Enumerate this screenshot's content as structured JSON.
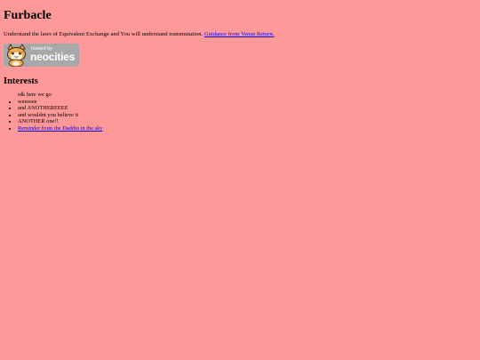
{
  "page": {
    "title": "Furbacle",
    "intro_text": "Understand the laws of Equivalent Exchange and You will understand transmutation.",
    "intro_link": "Guidance from Venus Return.",
    "badge": {
      "small_text": "hosted by",
      "big_text": "neocities",
      "bg_color": "#a8a8a8"
    },
    "interests_heading": "Interests",
    "interests": [
      "idk here we go",
      "weeeeee",
      "and ANOTHEREEEE",
      "and wouldnt you believe it",
      "ANOTHER one!!"
    ],
    "interests_link": "Reminder from the Daddio in the sky",
    "colors": {
      "background": "#ff9999",
      "link": "#0000ee"
    }
  }
}
